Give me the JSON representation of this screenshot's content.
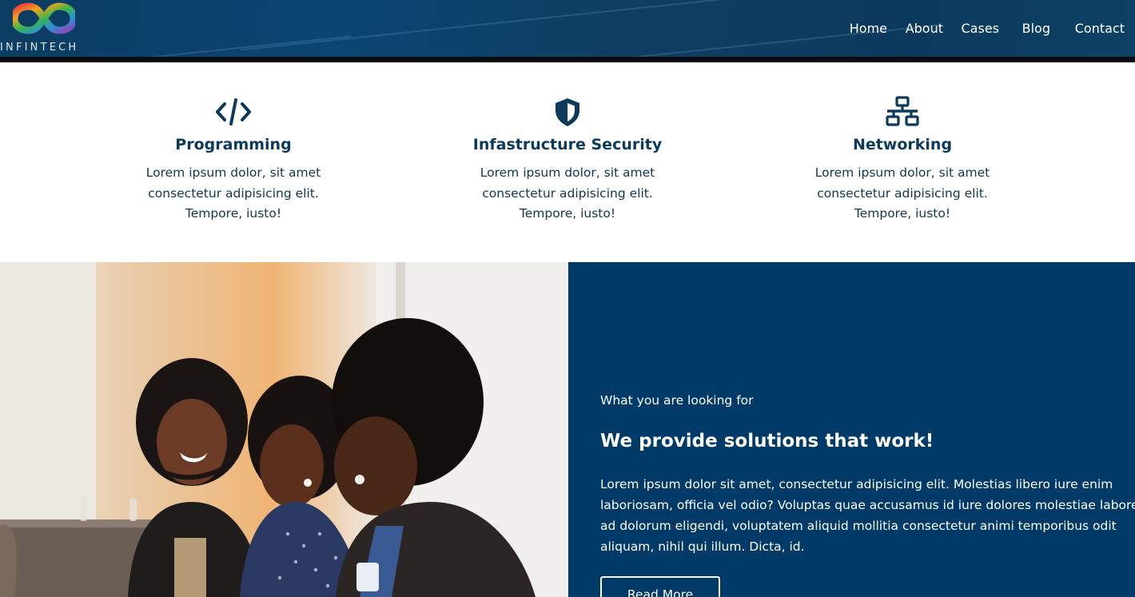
{
  "brand": {
    "name": "INFINTECH",
    "logo_icon": "infinity-logo-icon"
  },
  "nav": {
    "items": [
      {
        "label": "Home"
      },
      {
        "label": "About"
      },
      {
        "label": "Cases"
      },
      {
        "label": "Blog"
      },
      {
        "label": "Contact"
      }
    ]
  },
  "features": [
    {
      "icon": "code-icon",
      "title": "Programming",
      "text": "Lorem ipsum dolor, sit amet consectetur adipisicing elit. Tempore, iusto!"
    },
    {
      "icon": "shield-icon",
      "title": "Infastructure Security",
      "text": "Lorem ipsum dolor, sit amet consectetur adipisicing elit. Tempore, iusto!"
    },
    {
      "icon": "network-icon",
      "title": "Networking",
      "text": "Lorem ipsum dolor, sit amet consectetur adipisicing elit. Tempore, iusto!"
    }
  ],
  "about": {
    "kicker": "What you are looking for",
    "heading": "We provide solutions that work!",
    "body": "Lorem ipsum dolor sit amet, consectetur adipisicing elit. Molestias libero iure enim laboriosam, officia vel odio? Voluptas quae accusamus id iure dolores molestiae labore ad dolorum eligendi, voluptatem aliquid mollitia consectetur animi temporibus odit aliquam, nihil qui illum. Dicta, id.",
    "button_label": "Read More"
  },
  "colors": {
    "brand_navy": "#003a68",
    "heading_navy": "#0c3a5c",
    "header_bg": "#0c3d63"
  }
}
